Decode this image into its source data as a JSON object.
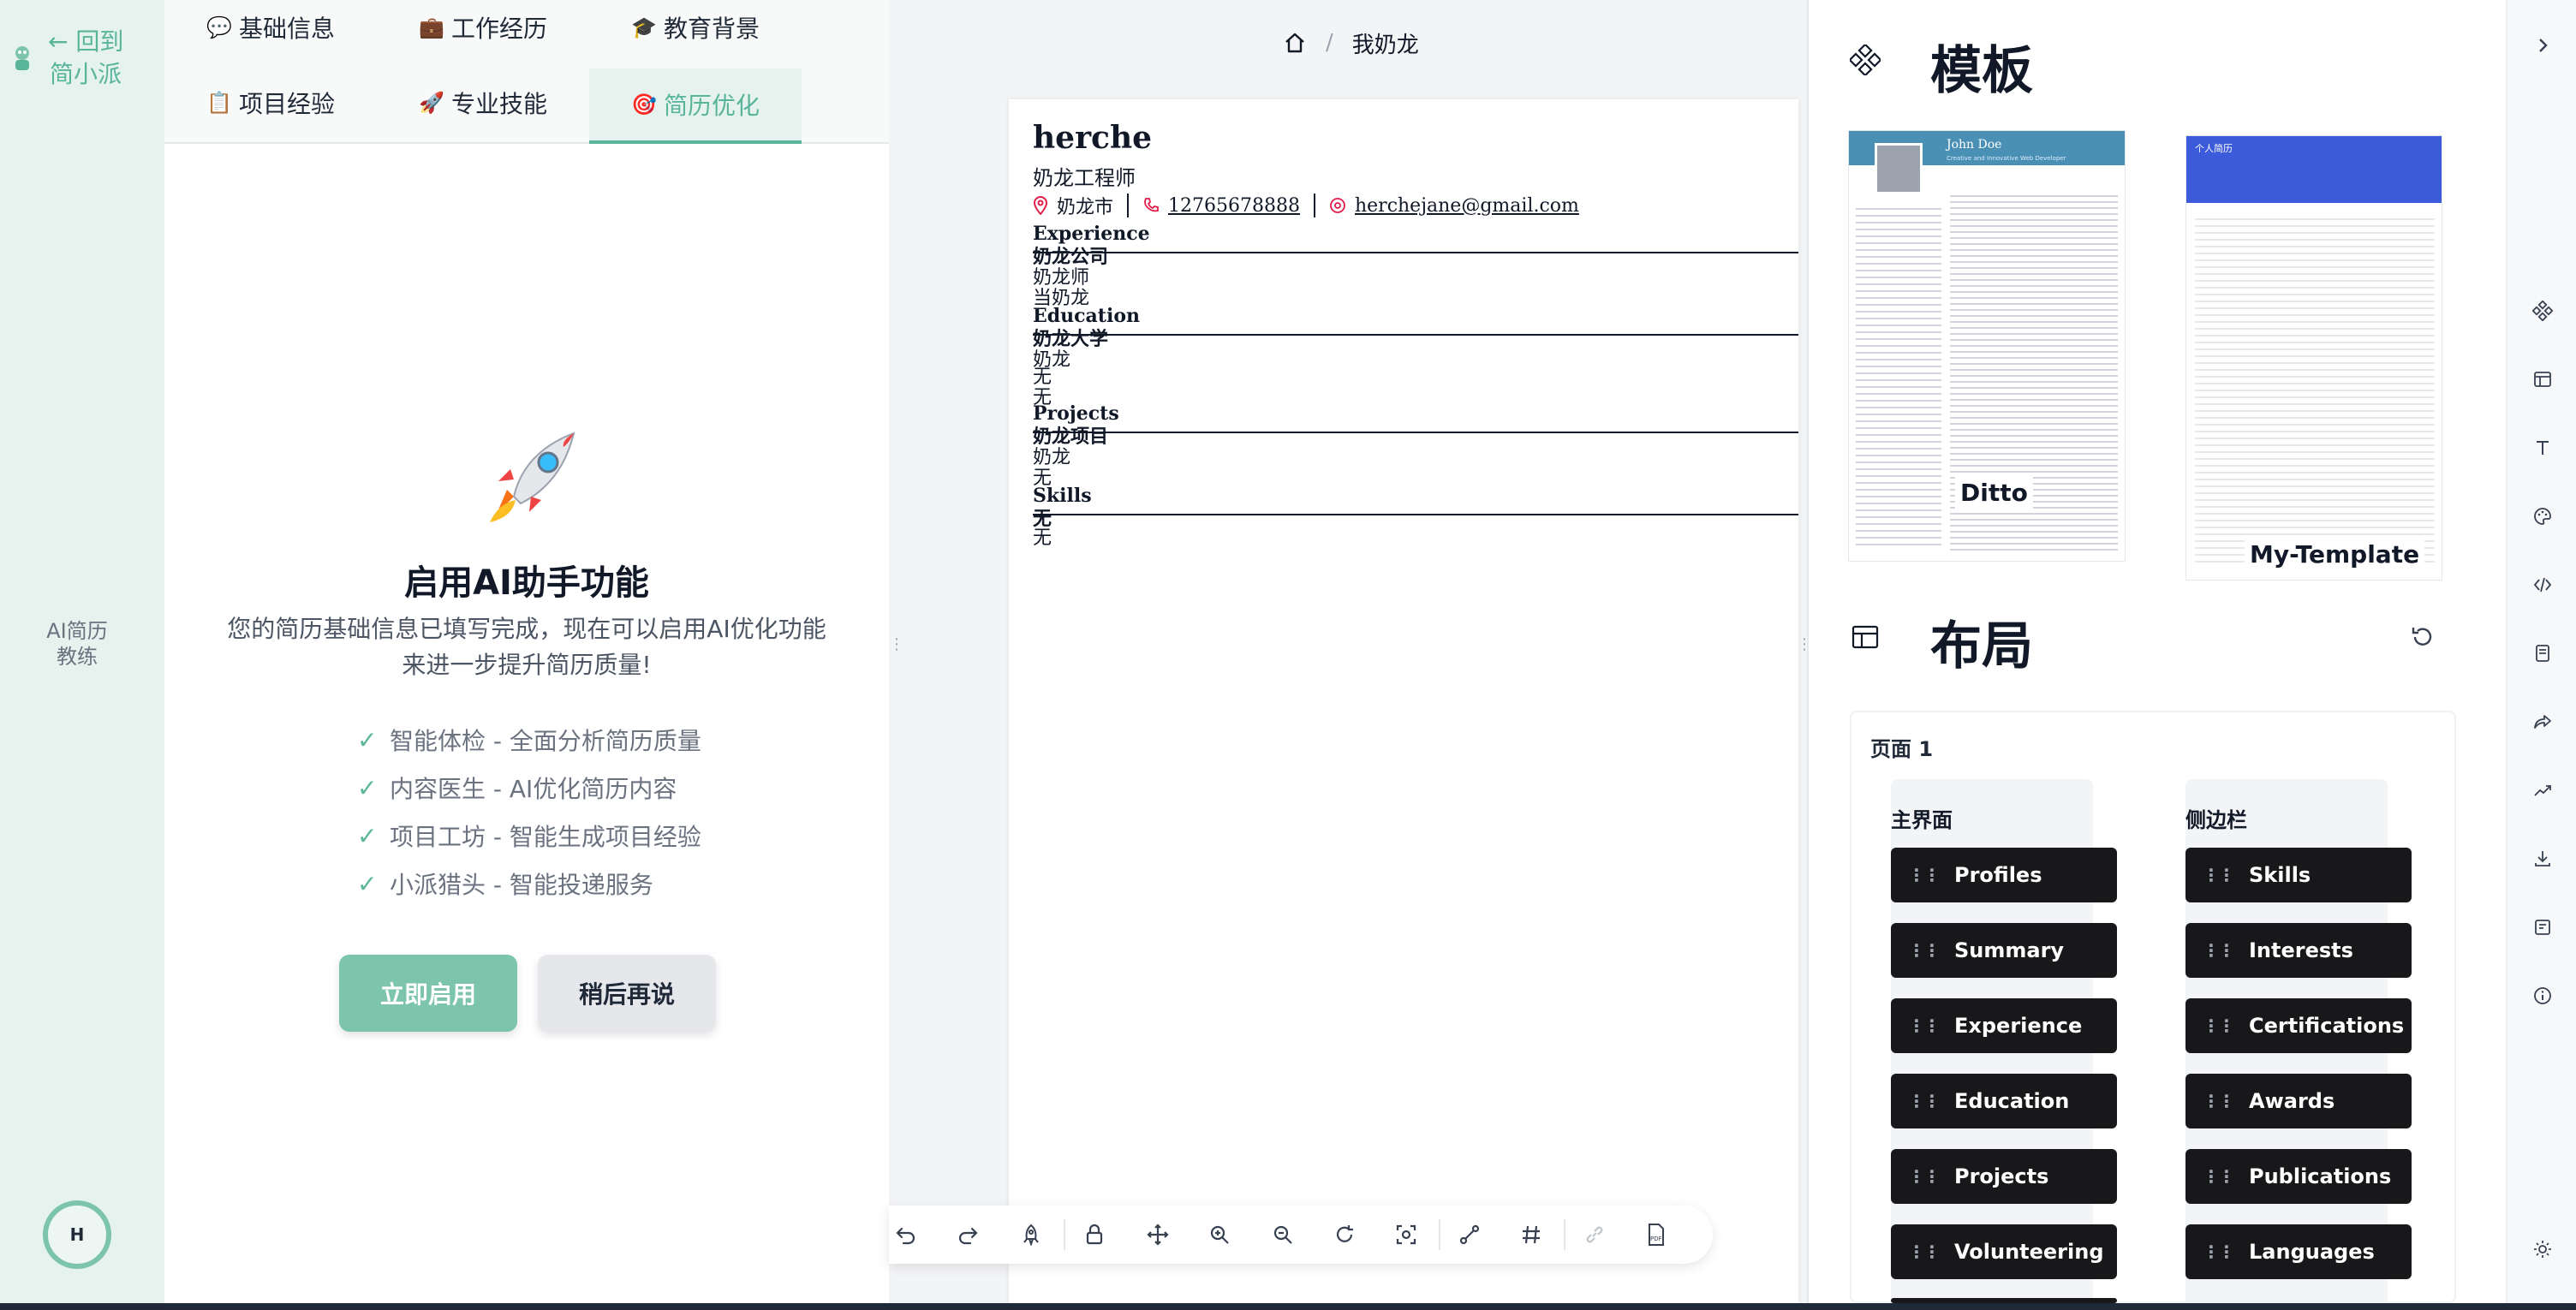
{
  "rail": {
    "back_line1": "← 回到",
    "back_line2": "简小派",
    "coach_line1": "AI简历",
    "coach_line2": "教练",
    "avatar_initial": "H"
  },
  "tabs": [
    {
      "emoji": "💬",
      "label": "基础信息"
    },
    {
      "emoji": "💼",
      "label": "工作经历"
    },
    {
      "emoji": "🎓",
      "label": "教育背景"
    },
    {
      "emoji": "📋",
      "label": "项目经验"
    },
    {
      "emoji": "🚀",
      "label": "专业技能"
    },
    {
      "emoji": "🎯",
      "label": "简历优化"
    }
  ],
  "ai": {
    "title": "启用AI助手功能",
    "desc_line1": "您的简历基础信息已填写完成，现在可以启用AI优化功能",
    "desc_line2": "来进一步提升简历质量!",
    "features": [
      "智能体检 - 全面分析简历质量",
      "内容医生 - AI优化简历内容",
      "项目工坊 - 智能生成项目经验",
      "小派猎头 - 智能投递服务"
    ],
    "enable_label": "立即启用",
    "later_label": "稍后再说"
  },
  "breadcrumb": {
    "current": "我奶龙"
  },
  "resume": {
    "name": "herche",
    "title": "奶龙工程师",
    "city": "奶龙市",
    "phone": "12765678888",
    "email": "herchejane@gmail.com",
    "sections": {
      "experience": "Experience",
      "education": "Education",
      "projects": "Projects",
      "skills": "Skills"
    },
    "experience": {
      "company": "奶龙公司",
      "role": "奶龙师",
      "desc": "当奶龙"
    },
    "education": {
      "school": "奶龙大学",
      "major": "奶龙",
      "line1": "无",
      "line2": "无"
    },
    "projects": {
      "name": "奶龙项目",
      "role": "奶龙",
      "desc": "无"
    },
    "skills": {
      "name": "无",
      "desc": "无"
    }
  },
  "right": {
    "templates_heading": "模板",
    "layout_heading": "布局",
    "templates": [
      {
        "label": "Ditto",
        "sample_name": "John Doe",
        "sample_sub": "Creative and Innovative Web Developer"
      },
      {
        "label": "My-Template",
        "sample_name": "个人简历"
      }
    ],
    "page_label": "页面 1",
    "main_col": "主界面",
    "side_col": "侧边栏",
    "main_blocks": [
      "Profiles",
      "Summary",
      "Experience",
      "Education",
      "Projects",
      "Volunteering"
    ],
    "side_blocks": [
      "Skills",
      "Interests",
      "Certifications",
      "Awards",
      "Publications",
      "Languages"
    ]
  },
  "colors": {
    "accent": "#59b59a",
    "accent_light": "#7dc4ad",
    "rail_bg": "#e6f2ee",
    "block_bg": "#18181b"
  },
  "icons": [
    "home-icon",
    "undo-icon",
    "redo-icon",
    "rocket-icon",
    "lock-icon",
    "move-icon",
    "zoom-in-icon",
    "zoom-out-icon",
    "reset-icon",
    "screenshot-icon",
    "link-icon",
    "grid-icon",
    "unlink-icon",
    "pdf-icon",
    "templates-icon",
    "layout-icon",
    "typography-icon",
    "palette-icon",
    "code-icon",
    "notes-icon",
    "share-icon",
    "statistics-icon",
    "download-icon",
    "information-icon",
    "sun-icon",
    "chevron-right-icon",
    "close-icon"
  ]
}
